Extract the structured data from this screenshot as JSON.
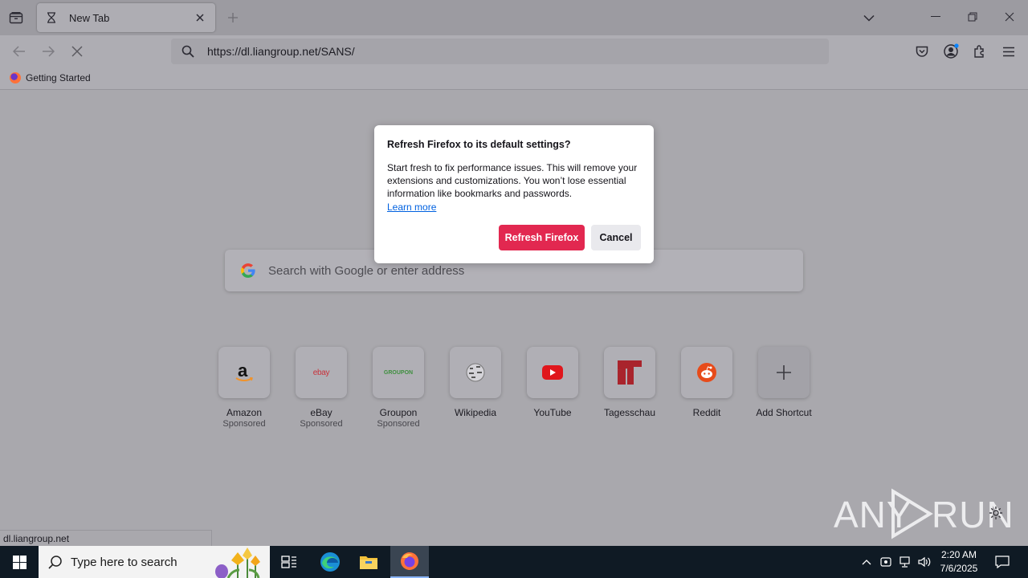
{
  "tabs": [
    {
      "title": "New Tab"
    }
  ],
  "urlbar": {
    "url": "https://dl.liangroup.net/SANS/"
  },
  "bookmarks": [
    {
      "label": "Getting Started"
    }
  ],
  "search": {
    "placeholder": "Search with Google or enter address"
  },
  "shortcuts": [
    {
      "name": "Amazon",
      "sub": "Sponsored",
      "logo_text": "a"
    },
    {
      "name": "eBay",
      "sub": "Sponsored",
      "logo_text": "ebay"
    },
    {
      "name": "Groupon",
      "sub": "Sponsored",
      "logo_text": "GROUPON"
    },
    {
      "name": "Wikipedia",
      "sub": ""
    },
    {
      "name": "YouTube",
      "sub": ""
    },
    {
      "name": "Tagesschau",
      "sub": ""
    },
    {
      "name": "Reddit",
      "sub": ""
    },
    {
      "name": "Add Shortcut",
      "sub": ""
    }
  ],
  "dialog": {
    "title": "Refresh Firefox to its default settings?",
    "body": "Start fresh to fix performance issues. This will remove your extensions and customizations. You won’t lose essential information like bookmarks and passwords.",
    "link": "Learn more",
    "primary_button": "Refresh Firefox",
    "secondary_button": "Cancel"
  },
  "status_text": "dl.liangroup.net",
  "watermark": {
    "left": "ANY",
    "right": "RUN"
  },
  "taskbar": {
    "search_placeholder": "Type here to search",
    "time": "2:20 AM",
    "date": "7/6/2025"
  },
  "colors": {
    "primary_button": "#e22850",
    "link": "#0061e0",
    "taskbar": "#0f1a24"
  }
}
